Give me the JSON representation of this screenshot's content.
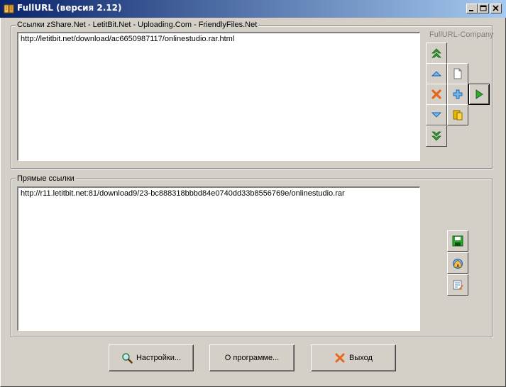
{
  "window": {
    "title": "FullURL (версия 2.12)",
    "controls": [
      "minimize",
      "maximize",
      "close"
    ]
  },
  "links_group": {
    "label": "Ссылки zShare.Net - LetitBit.Net - Uploading.Com - FriendlyFiles.Net",
    "value": "http://letitbit.net/download/ac6650987117/onlinestudio.rar.html"
  },
  "company_label": "FullURL-Company",
  "direct_group": {
    "label": "Прямые ссылки",
    "value": "http://r11.letitbit.net:81/download9/23-bc888318bbbd84e0740dd33b8556769e/onlinestudio.rar"
  },
  "buttons": {
    "settings": "Настройки...",
    "about": "О программе...",
    "exit": "Выход"
  },
  "colors": {
    "title_start": "#0a246a",
    "title_end": "#a6caf0",
    "face": "#d4d0c8",
    "green_arrow": "#2ea82e",
    "blue_arrow": "#3b8fd9",
    "red_x": "#e8651c"
  },
  "icons": [
    "move-top-icon",
    "move-up-icon",
    "delete-icon",
    "move-down-icon",
    "move-bottom-icon",
    "new-icon",
    "add-icon",
    "paste-icon",
    "run-icon",
    "save-icon",
    "home-icon",
    "edit-icon",
    "search-icon",
    "close-x-icon"
  ]
}
